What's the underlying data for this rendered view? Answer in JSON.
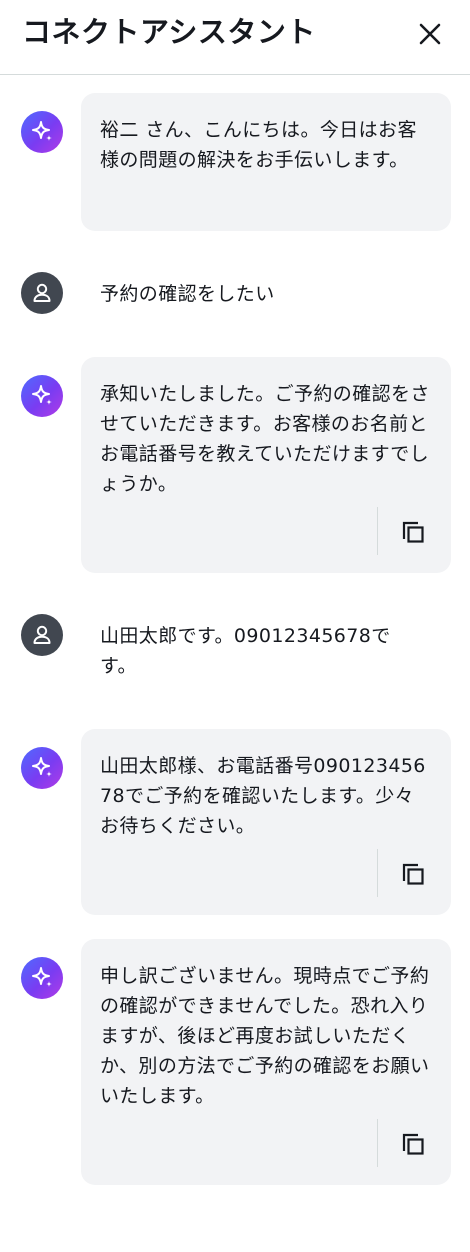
{
  "header": {
    "title": "コネクトアシスタント"
  },
  "icons": {
    "close": "close-icon",
    "bot_avatar": "sparkle-icon",
    "user_avatar": "person-icon",
    "copy": "copy-icon"
  },
  "colors": {
    "bot_gradient_start": "#4d6bff",
    "bot_gradient_end": "#b13be6",
    "user_avatar": "#414750",
    "bubble": "#f2f3f5"
  },
  "messages": [
    {
      "role": "assistant",
      "text": "裕二 さん、こんにちは。今日はお客様の問題の解決をお手伝いします。"
    },
    {
      "role": "user",
      "text": "予約の確認をしたい"
    },
    {
      "role": "assistant",
      "text": "承知いたしました。ご予約の確認をさせていただきます。お客様のお名前とお電話番号を教えていただけますでしょうか。"
    },
    {
      "role": "user",
      "text": "山田太郎です。09012345678です。"
    },
    {
      "role": "assistant",
      "text": "山田太郎様、お電話番号09012345678でご予約を確認いたします。少々お待ちください。"
    },
    {
      "role": "assistant",
      "text": "申し訳ございません。現時点でご予約の確認ができませんでした。恐れ入りますが、後ほど再度お試しいただくか、別の方法でご予約の確認をお願いいたします。"
    }
  ]
}
